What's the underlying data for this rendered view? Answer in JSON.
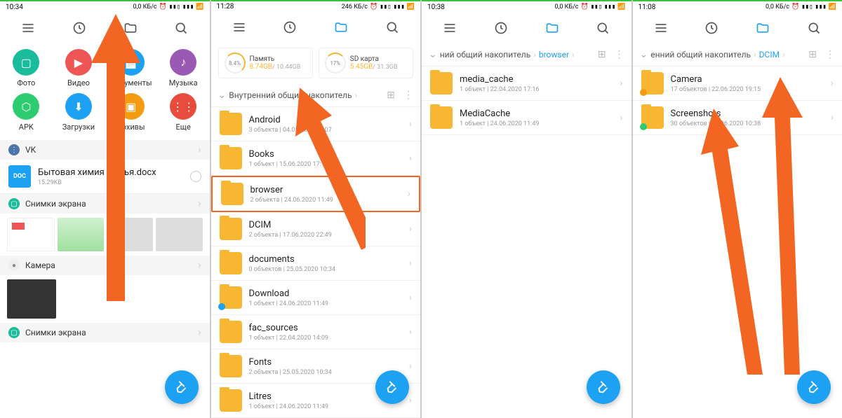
{
  "screens": [
    {
      "time": "10:34",
      "net": "0,0 КБ/с",
      "categories": [
        {
          "label": "Фото",
          "color": "#1abc9c",
          "glyph": "img"
        },
        {
          "label": "Видео",
          "color": "#e55",
          "glyph": "vid"
        },
        {
          "label": "Документы",
          "color": "#1da1f2",
          "glyph": "doc"
        },
        {
          "label": "Музыка",
          "color": "#9b59b6",
          "glyph": "mus"
        },
        {
          "label": "APK",
          "color": "#2ecc71",
          "glyph": "apk"
        },
        {
          "label": "Загрузки",
          "color": "#1da1f2",
          "glyph": "dl"
        },
        {
          "label": "Архивы",
          "color": "#f39c12",
          "glyph": "zip"
        },
        {
          "label": "Еще",
          "color": "#e74c3c",
          "glyph": "more"
        }
      ],
      "sections": {
        "vk": "VK",
        "doc_title": "Бытовая химия Семья.docx",
        "doc_size": "15.29KB",
        "doc_badge": "DOC",
        "shots1": "Снимки экрана",
        "camera": "Камера",
        "shots2": "Снимки экрана"
      }
    },
    {
      "time": "11:28",
      "net": "246 КБ/с",
      "storage": {
        "int_label": "Память",
        "int_pct": "8.4%",
        "int_used": "8.74GB",
        "int_total": "/ 10.44GB",
        "sd_label": "SD карта",
        "sd_pct": "17%",
        "sd_used": "5.45GB",
        "sd_total": "/ 31.3GB"
      },
      "crumb": "Внутренний общий накопитель",
      "folders": [
        {
          "name": "Android",
          "sub": "3 объекта  |  04.05.2020 10:07"
        },
        {
          "name": "Books",
          "sub": "1 объект  |  15.06.2020 17:12"
        },
        {
          "name": "browser",
          "sub": "2 объекта  |  24.06.2020 11:49",
          "hl": true
        },
        {
          "name": "DCIM",
          "sub": "2 объекта  |  17.06.2020 22:49"
        },
        {
          "name": "documents",
          "sub": "0 объектов  |  25.05.2020 10:34"
        },
        {
          "name": "Download",
          "sub": "1 объект  |  24.06.2020 11:49",
          "badge": "#1da1f2"
        },
        {
          "name": "fac_sources",
          "sub": "1 объект  |  22.04.2020 14:09"
        },
        {
          "name": "Fonts",
          "sub": "2 объекта  |  25.05.2020 10:34"
        },
        {
          "name": "Litres",
          "sub": "1 объект  |  24.06.2020 11:49"
        }
      ]
    },
    {
      "time": "10:38",
      "net": "0,0 КБ/с",
      "crumb_pre": "ний общий накопитель",
      "crumb_cur": "browser",
      "folders": [
        {
          "name": "media_cache",
          "sub": "1 объект  |  22.04.2020 17:16"
        },
        {
          "name": "MediaCache",
          "sub": "1 объект  |  24.06.2020 11:49"
        }
      ]
    },
    {
      "time": "11:08",
      "net": "0,0 КБ/с",
      "crumb_pre": "енний общий накопитель",
      "crumb_cur": "DCIM",
      "folders": [
        {
          "name": "Camera",
          "sub": "17 объектов  |  22.06.2020 19:15",
          "badge": "#f39c12"
        },
        {
          "name": "Screenshots",
          "sub": "30 объектов  |  25.06.2020 10:38",
          "badge": "#2ecc71"
        }
      ]
    }
  ]
}
